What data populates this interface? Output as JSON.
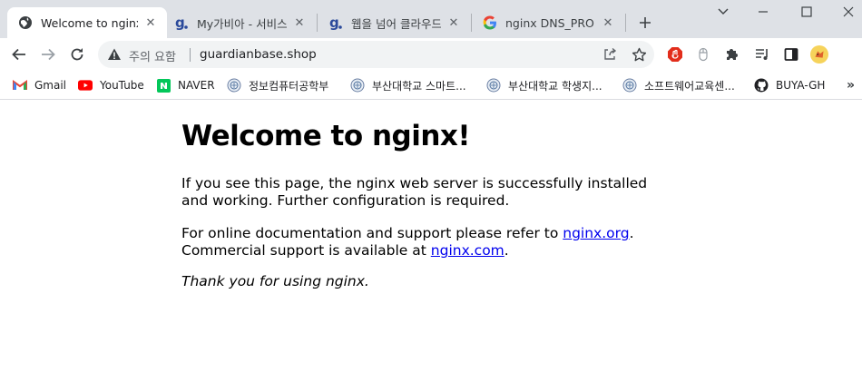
{
  "tabs": [
    {
      "title": "Welcome to nginx!",
      "active": true,
      "favicon": "globe-icon"
    },
    {
      "title": "My가비아 - 서비스",
      "active": false,
      "favicon": "gabia-icon"
    },
    {
      "title": "웹을 넘어 클라우드",
      "active": false,
      "favicon": "gabia-icon"
    },
    {
      "title": "nginx DNS_PROBE_",
      "active": false,
      "favicon": "google-icon"
    }
  ],
  "address_bar": {
    "security_label": "주의 요함",
    "url": "guardianbase.shop"
  },
  "bookmarks": [
    {
      "label": "Gmail",
      "icon": "gmail-icon"
    },
    {
      "label": "YouTube",
      "icon": "youtube-icon"
    },
    {
      "label": "NAVER",
      "icon": "naver-icon"
    },
    {
      "label": "정보컴퓨터공학부",
      "icon": "university-icon"
    },
    {
      "label": "부산대학교 스마트...",
      "icon": "university-icon"
    },
    {
      "label": "부산대학교 학생지...",
      "icon": "university-icon"
    },
    {
      "label": "소프트웨어교육센...",
      "icon": "university-icon"
    },
    {
      "label": "BUYA-GH",
      "icon": "github-icon"
    }
  ],
  "page": {
    "heading": "Welcome to nginx!",
    "para1": "If you see this page, the nginx web server is successfully installed and working. Further configuration is required.",
    "para2_text1": "For online documentation and support please refer to ",
    "para2_link1": "nginx.org",
    "para2_text2": ".",
    "para2_text3": "Commercial support is available at ",
    "para2_link2": "nginx.com",
    "para2_text4": ".",
    "para3": "Thank you for using nginx."
  }
}
